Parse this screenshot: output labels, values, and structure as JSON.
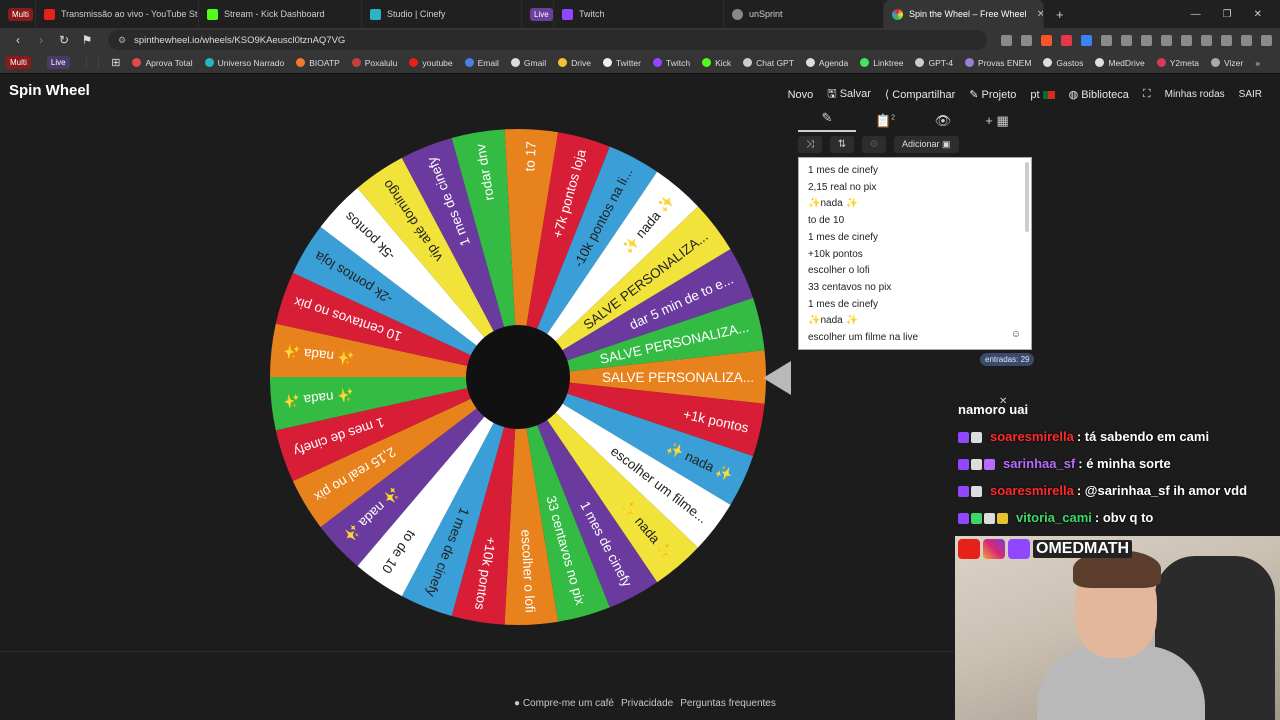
{
  "browser": {
    "tabs": [
      {
        "label": "Multi",
        "active": false
      },
      {
        "label": "Transmissão ao vivo - YouTube Studio",
        "active": false
      },
      {
        "label": "Stream - Kick Dashboard",
        "active": false
      },
      {
        "label": "Studio | Cinefy",
        "active": false
      },
      {
        "label": "Live",
        "active": false
      },
      {
        "label": "Twitch",
        "active": false
      },
      {
        "label": "unSprint",
        "active": false
      },
      {
        "label": "Spin the Wheel – Free Wheel",
        "active": true
      }
    ],
    "url": "spinthewheel.io/wheels/KSO9KAeuscl0tznAQ7VG",
    "bookmarks_left": [
      "Multi",
      "Live"
    ],
    "bookmarks": [
      "Aprova Total",
      "Universo Narrado",
      "BIOATP",
      "Poxalulu",
      "youtube",
      "Email",
      "Gmail",
      "Drive",
      "Twitter",
      "Twitch",
      "Kick",
      "Chat GPT",
      "Agenda",
      "Linktree",
      "GPT-4",
      "Provas ENEM",
      "Gastos",
      "MedDrive",
      "Y2meta",
      "Vizer"
    ]
  },
  "app": {
    "logo": "Spin Wheel",
    "menu": {
      "novo": "Novo",
      "salvar": "Salvar",
      "compartilhar": "Compartilhar",
      "projeto": "Projeto",
      "lang": "pt",
      "biblioteca": "Biblioteca",
      "minhas_rodas": "Minhas rodas",
      "sair": "SAIR"
    },
    "panel": {
      "tab_badge": "2",
      "add_button": "Adicionar",
      "entries": [
        "1 mes de cinefy",
        "2,15 real no pix",
        "✨nada ✨",
        "to de 10",
        "1 mes de cinefy",
        "+10k pontos",
        "escolher o lofi",
        "33 centavos no pix",
        "1 mes de cinefy",
        "✨nada ✨",
        "escolher um filme na live"
      ],
      "count_label": "entradas: 29"
    },
    "wheel": {
      "segments": [
        {
          "label": "SALVE PERSONALIZA...",
          "color": "#e8821d"
        },
        {
          "label": "+1k pontos",
          "color": "#d81e37"
        },
        {
          "label": "✨ nada ✨",
          "color": "#3a9fd6"
        },
        {
          "label": "escolher um filme...",
          "color": "#ffffff"
        },
        {
          "label": "✨ nada ✨",
          "color": "#f2e33a"
        },
        {
          "label": "1 mes de cinefy",
          "color": "#6a3a9e"
        },
        {
          "label": "33 centavos no pix",
          "color": "#33bb44"
        },
        {
          "label": "escolher o lofi",
          "color": "#e8821d"
        },
        {
          "label": "+10k pontos",
          "color": "#d81e37"
        },
        {
          "label": "1 mes de cinefy",
          "color": "#3a9fd6"
        },
        {
          "label": "to de 10",
          "color": "#ffffff"
        },
        {
          "label": "✨ nada ✨",
          "color": "#6a3a9e"
        },
        {
          "label": "2,15 real no pix",
          "color": "#e8821d"
        },
        {
          "label": "1 mes de cinefy",
          "color": "#d81e37"
        },
        {
          "label": "✨ nada ✨",
          "color": "#33bb44"
        },
        {
          "label": "✨ nada ✨",
          "color": "#e8821d"
        },
        {
          "label": "10 centavos no pix",
          "color": "#d81e37"
        },
        {
          "label": "-2k pontos loja",
          "color": "#3a9fd6"
        },
        {
          "label": "-5k pontos",
          "color": "#ffffff"
        },
        {
          "label": "vip até domingo",
          "color": "#f2e33a"
        },
        {
          "label": "1 mes de cinefy",
          "color": "#6a3a9e"
        },
        {
          "label": "rodar dnv",
          "color": "#33bb44"
        },
        {
          "label": "to 17",
          "color": "#e8821d"
        },
        {
          "label": "+7k pontos loja",
          "color": "#d81e37"
        },
        {
          "label": "-10k pontos na li...",
          "color": "#3a9fd6"
        },
        {
          "label": "✨ nada ✨",
          "color": "#ffffff"
        },
        {
          "label": "SALVE PERSONALIZA...",
          "color": "#f2e33a"
        },
        {
          "label": "dar 5 min de to e...",
          "color": "#6a3a9e"
        },
        {
          "label": "SALVE PERSONALIZA...",
          "color": "#33bb44"
        }
      ]
    },
    "footer": {
      "coffee": "Compre-me um café",
      "privacy": "Privacidade",
      "faq": "Perguntas frequentes"
    }
  },
  "chat": {
    "title": "namoro uai",
    "messages": [
      {
        "user": "soaresmirella",
        "color": "#ff2a2a",
        "text": ": tá sabendo em cami"
      },
      {
        "user": "sarinhaa_sf",
        "color": "#b86cff",
        "text": ": é minha sorte"
      },
      {
        "user": "soaresmirella",
        "color": "#ff2a2a",
        "text": ": @sarinhaa_sf ih amor vdd"
      },
      {
        "user": "vitoria_cami",
        "color": "#3ed66a",
        "text": ": obv q to"
      }
    ]
  },
  "webcam": {
    "channel": "OMEDMATH"
  }
}
